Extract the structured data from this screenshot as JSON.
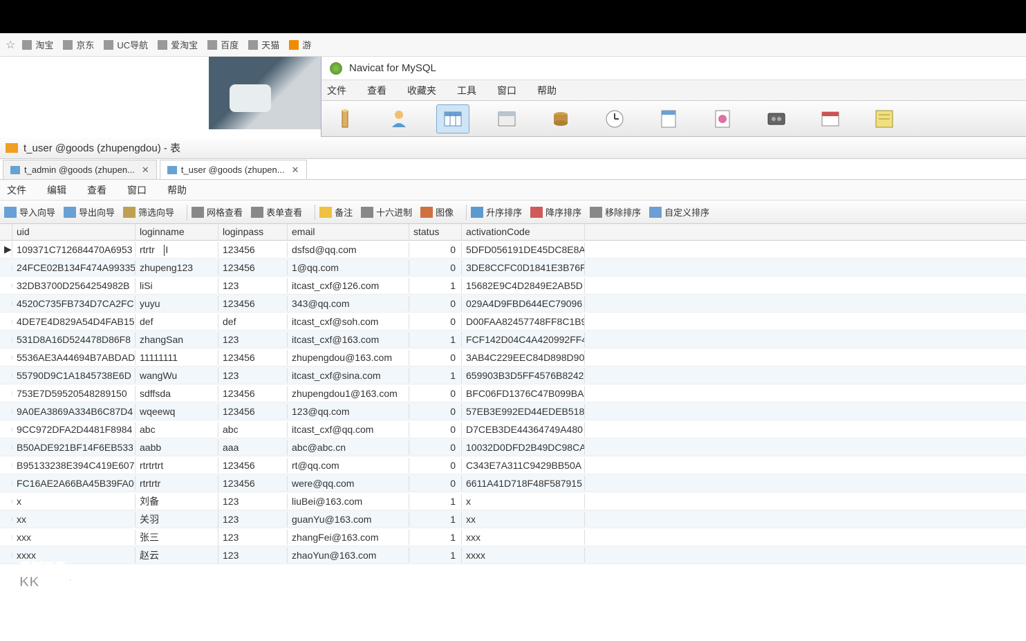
{
  "browser_bookmarks": [
    "淘宝",
    "京东",
    "UC导航",
    "爱淘宝",
    "百度",
    "天猫",
    "游"
  ],
  "navicat": {
    "title": "Navicat for MySQL",
    "menu": [
      "文件",
      "查看",
      "收藏夹",
      "工具",
      "窗口",
      "帮助"
    ]
  },
  "table_window_title": "t_user @goods (zhupengdou) - 表",
  "tabs": [
    {
      "label": "t_admin @goods (zhupen...",
      "active": false
    },
    {
      "label": "t_user @goods (zhupen...",
      "active": true
    }
  ],
  "sub_menu": [
    "文件",
    "编辑",
    "查看",
    "窗口",
    "帮助"
  ],
  "toolbar": {
    "import": "导入向导",
    "export": "导出向导",
    "filter": "筛选向导",
    "gridview": "网格查看",
    "formview": "表单查看",
    "memo": "备注",
    "hex": "十六进制",
    "image": "图像",
    "asc": "升序排序",
    "desc": "降序排序",
    "removesort": "移除排序",
    "customsort": "自定义排序"
  },
  "columns": [
    "uid",
    "loginname",
    "loginpass",
    "email",
    "status",
    "activationCode"
  ],
  "active_cell": {
    "row": 0,
    "col": "loginname",
    "value": "rtrtr"
  },
  "rows": [
    {
      "uid": "109371C712684470A6953",
      "loginname": "rtrtr",
      "loginpass": "123456",
      "email": "dsfsd@qq.com",
      "status": "0",
      "activationCode": "5DFD056191DE45DC8E8A"
    },
    {
      "uid": "24FCE02B134F474A99335",
      "loginname": "zhupeng123",
      "loginpass": "123456",
      "email": "1@qq.com",
      "status": "0",
      "activationCode": "3DE8CCFC0D1841E3B76F"
    },
    {
      "uid": "32DB3700D2564254982B",
      "loginname": "liSi",
      "loginpass": "123",
      "email": "itcast_cxf@126.com",
      "status": "1",
      "activationCode": "15682E9C4D2849E2AB5D"
    },
    {
      "uid": "4520C735FB734D7CA2FC",
      "loginname": "yuyu",
      "loginpass": "123456",
      "email": "343@qq.com",
      "status": "0",
      "activationCode": "029A4D9FBD644EC79096"
    },
    {
      "uid": "4DE7E4D829A54D4FAB15",
      "loginname": "def",
      "loginpass": "def",
      "email": "itcast_cxf@soh.com",
      "status": "0",
      "activationCode": "D00FAA82457748FF8C1B9"
    },
    {
      "uid": "531D8A16D524478D86F8",
      "loginname": "zhangSan",
      "loginpass": "123",
      "email": "itcast_cxf@163.com",
      "status": "1",
      "activationCode": "FCF142D04C4A420992FF4"
    },
    {
      "uid": "5536AE3A44694B7ABDAD",
      "loginname": "11111111",
      "loginpass": "123456",
      "email": "zhupengdou@163.com",
      "status": "0",
      "activationCode": "3AB4C229EEC84D898D90"
    },
    {
      "uid": "55790D9C1A1845738E6D",
      "loginname": "wangWu",
      "loginpass": "123",
      "email": "itcast_cxf@sina.com",
      "status": "1",
      "activationCode": "659903B3D5FF4576B8242"
    },
    {
      "uid": "753E7D59520548289150",
      "loginname": "sdffsda",
      "loginpass": "123456",
      "email": "zhupengdou1@163.com",
      "status": "0",
      "activationCode": "BFC06FD1376C47B099BA"
    },
    {
      "uid": "9A0EA3869A334B6C87D4",
      "loginname": "wqeewq",
      "loginpass": "123456",
      "email": "123@qq.com",
      "status": "0",
      "activationCode": "57EB3E992ED44EDEB518"
    },
    {
      "uid": "9CC972DFA2D4481F8984",
      "loginname": "abc",
      "loginpass": "abc",
      "email": "itcast_cxf@qq.com",
      "status": "0",
      "activationCode": "D7CEB3DE44364749A480"
    },
    {
      "uid": "B50ADE921BF14F6EB533",
      "loginname": "aabb",
      "loginpass": "aaa",
      "email": "abc@abc.cn",
      "status": "0",
      "activationCode": "10032D0DFD2B49DC98CA"
    },
    {
      "uid": "B95133238E394C419E607",
      "loginname": "rtrtrtrt",
      "loginpass": "123456",
      "email": "rt@qq.com",
      "status": "0",
      "activationCode": "C343E7A311C9429BB50A"
    },
    {
      "uid": "FC16AE2A66BA45B39FA0",
      "loginname": "rtrtrtr",
      "loginpass": "123456",
      "email": "were@qq.com",
      "status": "0",
      "activationCode": "6611A41D718F48F587915"
    },
    {
      "uid": "x",
      "loginname": "刘备",
      "loginpass": "123",
      "email": "liuBei@163.com",
      "status": "1",
      "activationCode": "x"
    },
    {
      "uid": "xx",
      "loginname": "关羽",
      "loginpass": "123",
      "email": "guanYu@163.com",
      "status": "1",
      "activationCode": "xx"
    },
    {
      "uid": "xxx",
      "loginname": "张三",
      "loginpass": "123",
      "email": "zhangFei@163.com",
      "status": "1",
      "activationCode": "xxx"
    },
    {
      "uid": "xxxx",
      "loginname": "赵云",
      "loginpass": "123",
      "email": "zhaoYun@163.com",
      "status": "1",
      "activationCode": "xxxx"
    }
  ],
  "watermark": {
    "l1": "录制工具",
    "l2": "KK录像机"
  }
}
